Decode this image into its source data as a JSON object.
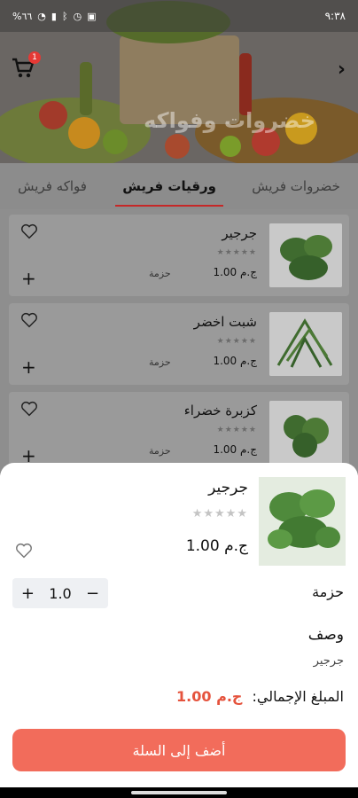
{
  "status_bar": {
    "time": "٩:٣٨",
    "battery": "%٦٦"
  },
  "header": {
    "title": "خضروات وفواكه",
    "cart_badge": "1"
  },
  "tabs": [
    {
      "label": "خضروات فريش"
    },
    {
      "label": "ورقيات فريش"
    },
    {
      "label": "فواكه فريش"
    }
  ],
  "products": [
    {
      "name": "جرجير",
      "price": "ج.م 1.00",
      "unit": "حزمة",
      "stars": "★★★★★"
    },
    {
      "name": "شبت اخضر",
      "price": "ج.م 1.00",
      "unit": "حزمة",
      "stars": "★★★★★"
    },
    {
      "name": "كزبرة خضراء",
      "price": "ج.م 1.00",
      "unit": "حزمة",
      "stars": "★★★★★"
    }
  ],
  "sheet": {
    "name": "جرجير",
    "stars": "★★★★★",
    "price": "ج.م 1.00",
    "unit_label": "حزمة",
    "quantity": "1.0",
    "minus": "−",
    "plus": "+",
    "description_title": "وصف",
    "description": "جرجير",
    "total_label": "المبلغ الإجمالي:",
    "total_amount": "ج.م 1.00",
    "add_button": "أضف إلى السلة"
  },
  "colors": {
    "accent": "#f26c5b",
    "total": "#e5533d",
    "tab_indicator": "#c62828"
  }
}
